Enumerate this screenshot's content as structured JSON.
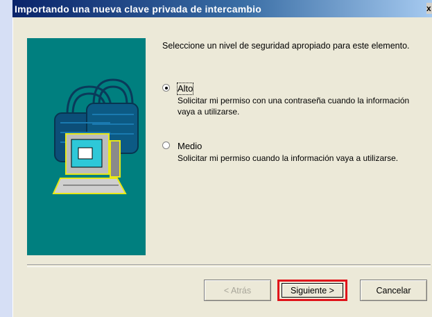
{
  "window": {
    "title": "Importando una nueva clave privada de intercambio",
    "close_label": "x"
  },
  "content": {
    "prompt": "Seleccione un nivel de seguridad apropiado para este elemento.",
    "options": [
      {
        "label": "Alto",
        "description": "Solicitar mi permiso con una contraseña cuando la información vaya a utilizarse.",
        "selected": true
      },
      {
        "label": "Medio",
        "description": "Solicitar mi permiso cuando la información vaya a utilizarse.",
        "selected": false
      }
    ]
  },
  "buttons": {
    "back": "< Atrás",
    "next": "Siguiente >",
    "cancel": "Cancelar"
  },
  "colors": {
    "art_background": "#007f7f",
    "highlight": "#e0121a"
  }
}
